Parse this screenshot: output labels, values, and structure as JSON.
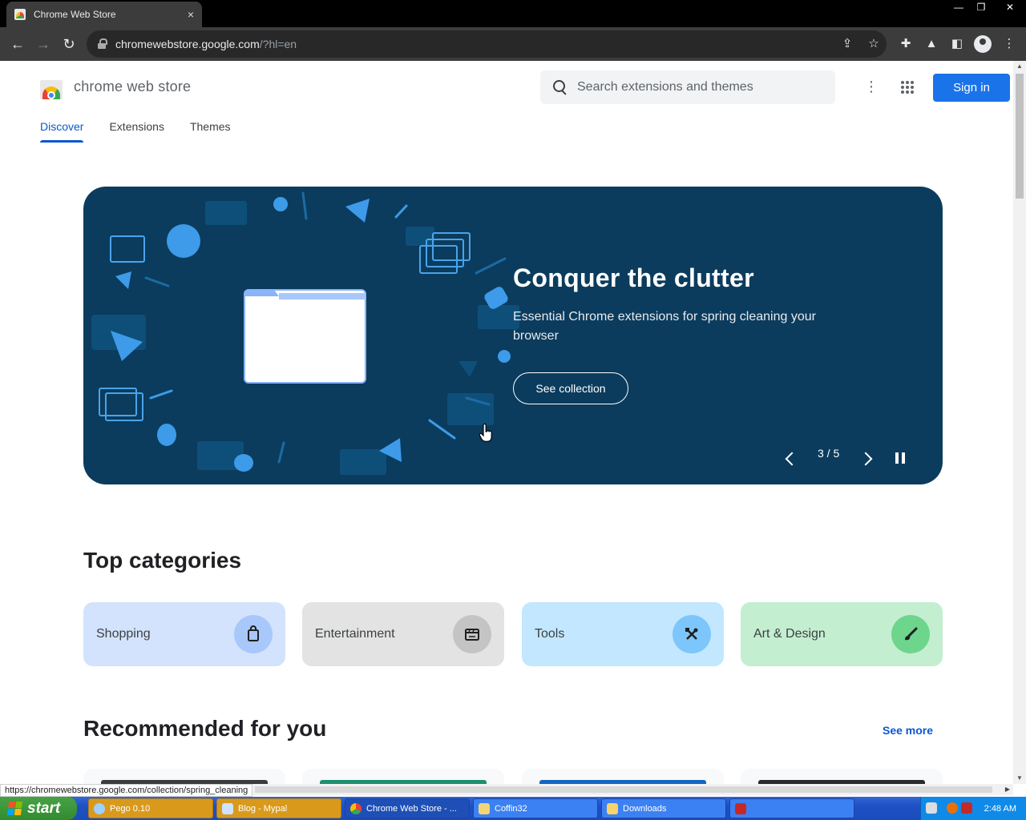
{
  "browser": {
    "tab_title": "Chrome Web Store",
    "tab_close": "×",
    "url_domain": "chromewebstore.google.com",
    "url_path": "/?hl=en",
    "window_controls": [
      "—",
      "❐",
      "✕"
    ]
  },
  "header": {
    "brand": "chrome web store",
    "search_placeholder": "Search extensions and themes",
    "signin_label": "Sign in"
  },
  "nav": {
    "tabs": [
      {
        "label": "Discover",
        "active": true
      },
      {
        "label": "Extensions",
        "active": false
      },
      {
        "label": "Themes",
        "active": false
      }
    ]
  },
  "hero": {
    "title": "Conquer the clutter",
    "subtitle": "Essential Chrome extensions for spring cleaning your browser",
    "button_label": "See collection",
    "pager": "3 / 5",
    "bg_color": "#0b3c5d",
    "accent_color": "#4aa3ea"
  },
  "categories": {
    "heading": "Top categories",
    "items": [
      {
        "label": "Shopping",
        "bg": "#d3e3fd",
        "icon_bg": "#a8c7fa",
        "icon": "shopping-bag-icon"
      },
      {
        "label": "Entertainment",
        "bg": "#e3e3e3",
        "icon_bg": "#c4c4c4",
        "icon": "clapperboard-icon"
      },
      {
        "label": "Tools",
        "bg": "#c2e7ff",
        "icon_bg": "#7cc6fb",
        "icon": "tools-icon"
      },
      {
        "label": "Art & Design",
        "bg": "#c4eed0",
        "icon_bg": "#6dd58c",
        "icon": "paintbrush-icon"
      }
    ]
  },
  "recommended": {
    "heading": "Recommended for you",
    "see_more": "See more"
  },
  "status_url": "https://chromewebstore.google.com/collection/spring_cleaning",
  "taskbar": {
    "start_label": "start",
    "tasks": [
      {
        "label": "Pego 0.10"
      },
      {
        "label": "Blog - Mypal"
      },
      {
        "label": "Chrome Web Store - ..."
      },
      {
        "label": "Coffin32"
      },
      {
        "label": "Downloads"
      },
      {
        "label": ""
      }
    ],
    "clock": "2:48 AM"
  }
}
